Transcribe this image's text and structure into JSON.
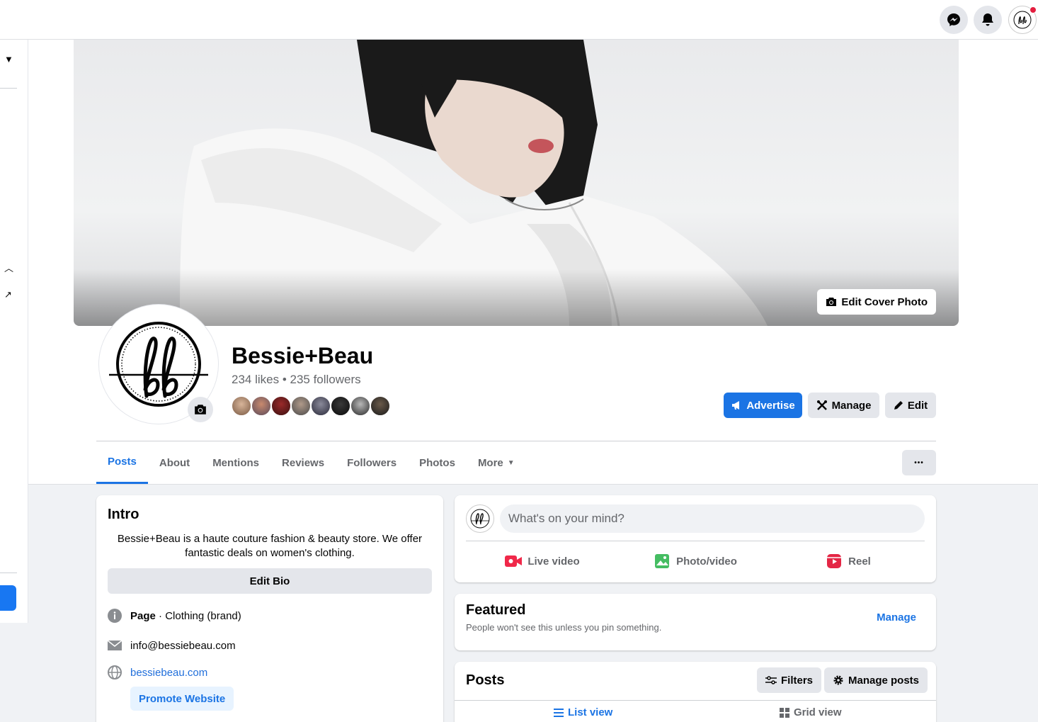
{
  "topbar": {
    "messenger_icon": "messenger-icon",
    "bell_icon": "bell-icon",
    "account_icon": "account-avatar"
  },
  "cover": {
    "edit_label": "Edit Cover Photo"
  },
  "page": {
    "name": "Bessie+Beau",
    "stats": "234 likes • 235 followers",
    "logo_text": "bb"
  },
  "actions": {
    "advertise": "Advertise",
    "manage": "Manage",
    "edit": "Edit"
  },
  "tabs": [
    {
      "label": "Posts",
      "active": true
    },
    {
      "label": "About"
    },
    {
      "label": "Mentions"
    },
    {
      "label": "Reviews"
    },
    {
      "label": "Followers"
    },
    {
      "label": "Photos"
    },
    {
      "label": "More"
    }
  ],
  "tab_more_dots": "•••",
  "intro": {
    "title": "Intro",
    "bio": "Bessie+Beau is a haute couture fashion & beauty store. We offer fantastic deals on women's clothing.",
    "edit_bio": "Edit Bio",
    "page_label": "Page",
    "page_category": " · Clothing (brand)",
    "email": "info@bessiebeau.com",
    "website": "bessiebeau.com",
    "promote": "Promote Website"
  },
  "composer": {
    "placeholder": "What's on your mind?",
    "live_video": "Live video",
    "photo_video": "Photo/video",
    "reel": "Reel"
  },
  "featured": {
    "title": "Featured",
    "subtitle": "People won't see this unless you pin something.",
    "manage": "Manage"
  },
  "posts": {
    "title": "Posts",
    "filters": "Filters",
    "manage_posts": "Manage posts",
    "list_view": "List view",
    "grid_view": "Grid view"
  },
  "colors": {
    "brand_blue": "#1b74e4",
    "notification_red": "#e41e3f"
  }
}
